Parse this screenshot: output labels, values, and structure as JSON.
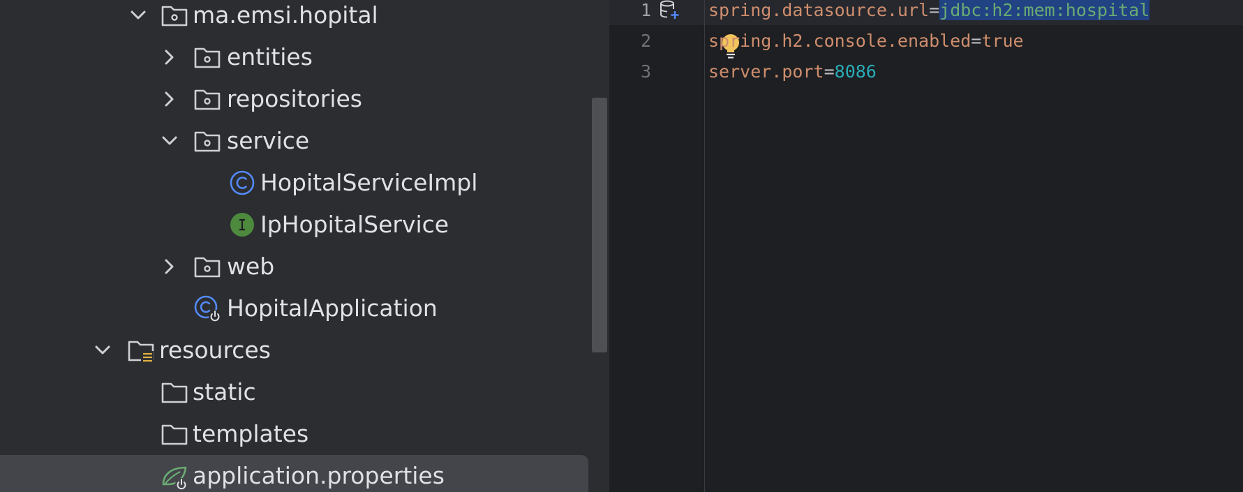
{
  "project_tree": {
    "items": [
      {
        "label": "ma.emsi.hopital",
        "icon": "package-folder-icon",
        "expanded": true
      },
      {
        "label": "entities",
        "icon": "package-folder-icon",
        "expanded": false
      },
      {
        "label": "repositories",
        "icon": "package-folder-icon",
        "expanded": false
      },
      {
        "label": "service",
        "icon": "package-folder-icon",
        "expanded": true
      },
      {
        "label": "HopitalServiceImpl",
        "icon": "class-icon"
      },
      {
        "label": "IpHopitalService",
        "icon": "interface-icon"
      },
      {
        "label": "web",
        "icon": "package-folder-icon",
        "expanded": false
      },
      {
        "label": "HopitalApplication",
        "icon": "spring-boot-class-icon"
      },
      {
        "label": "resources",
        "icon": "resources-folder-icon",
        "expanded": true
      },
      {
        "label": "static",
        "icon": "folder-icon"
      },
      {
        "label": "templates",
        "icon": "folder-icon"
      },
      {
        "label": "application.properties",
        "icon": "spring-properties-icon",
        "selected": true
      }
    ]
  },
  "editor": {
    "line_numbers": [
      "1",
      "2",
      "3"
    ],
    "lines": [
      {
        "key": "spring.datasource.url",
        "sep": "=",
        "value": "jdbc:h2:mem:hospital",
        "value_selected": true
      },
      {
        "key": "spring.h2.console.enabled",
        "sep": "=",
        "value": "true"
      },
      {
        "key": "server.port",
        "sep": "=",
        "value": "8086"
      }
    ],
    "gutter_icons": [
      "database-add-icon",
      "lightbulb-icon"
    ]
  },
  "colors": {
    "tree_bg": "#2b2d30",
    "editor_bg": "#1e1f22",
    "property_key": "#cf8e6d",
    "string_value": "#6aab73",
    "number_value": "#2aacb8",
    "selection": "#214283",
    "class_icon": "#548af7",
    "interface_icon": "#4e8a3e",
    "spring_green": "#6aab73"
  }
}
